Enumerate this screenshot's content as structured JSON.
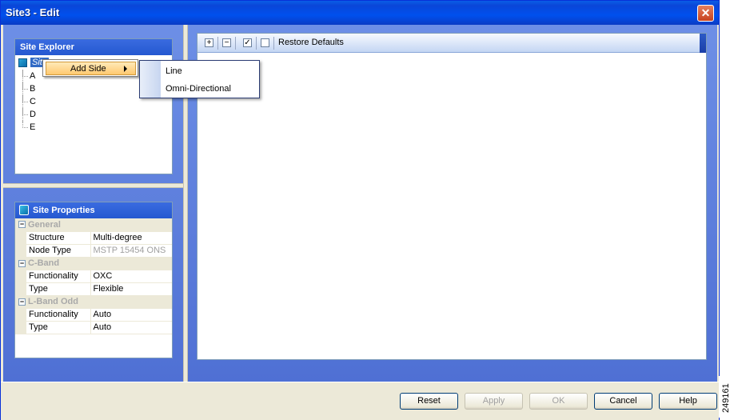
{
  "window": {
    "title": "Site3 - Edit",
    "close_glyph": "✕"
  },
  "explorer": {
    "header": "Site Explorer",
    "root_label": "Site",
    "items": [
      "A",
      "B",
      "C",
      "D",
      "E"
    ]
  },
  "context_menu": {
    "item": "Add Side"
  },
  "submenu": {
    "items": [
      "Line",
      "Omni-Directional"
    ]
  },
  "properties": {
    "header": "Site Properties",
    "groups": [
      {
        "name": "General",
        "rows": [
          {
            "name": "Structure",
            "value": "Multi-degree",
            "disabled": false
          },
          {
            "name": "Node Type",
            "value": "MSTP 15454 ONS",
            "disabled": true
          }
        ]
      },
      {
        "name": "C-Band",
        "rows": [
          {
            "name": "Functionality",
            "value": "OXC",
            "disabled": false
          },
          {
            "name": "Type",
            "value": "Flexible",
            "disabled": false
          }
        ]
      },
      {
        "name": "L-Band Odd",
        "rows": [
          {
            "name": "Functionality",
            "value": "Auto",
            "disabled": false
          },
          {
            "name": "Type",
            "value": "Auto",
            "disabled": false
          }
        ]
      }
    ]
  },
  "toolbar": {
    "expand_glyph": "+",
    "collapse_glyph": "−",
    "check_glyph": "✓",
    "restore_label": "Restore Defaults"
  },
  "buttons": {
    "reset": "Reset",
    "apply": "Apply",
    "ok": "OK",
    "cancel": "Cancel",
    "help": "Help"
  },
  "figure_id": "249161",
  "colors": {
    "accent": "#0a46d8",
    "panel_header": "#2c5ed4",
    "menu_highlight": "#ffc970"
  }
}
